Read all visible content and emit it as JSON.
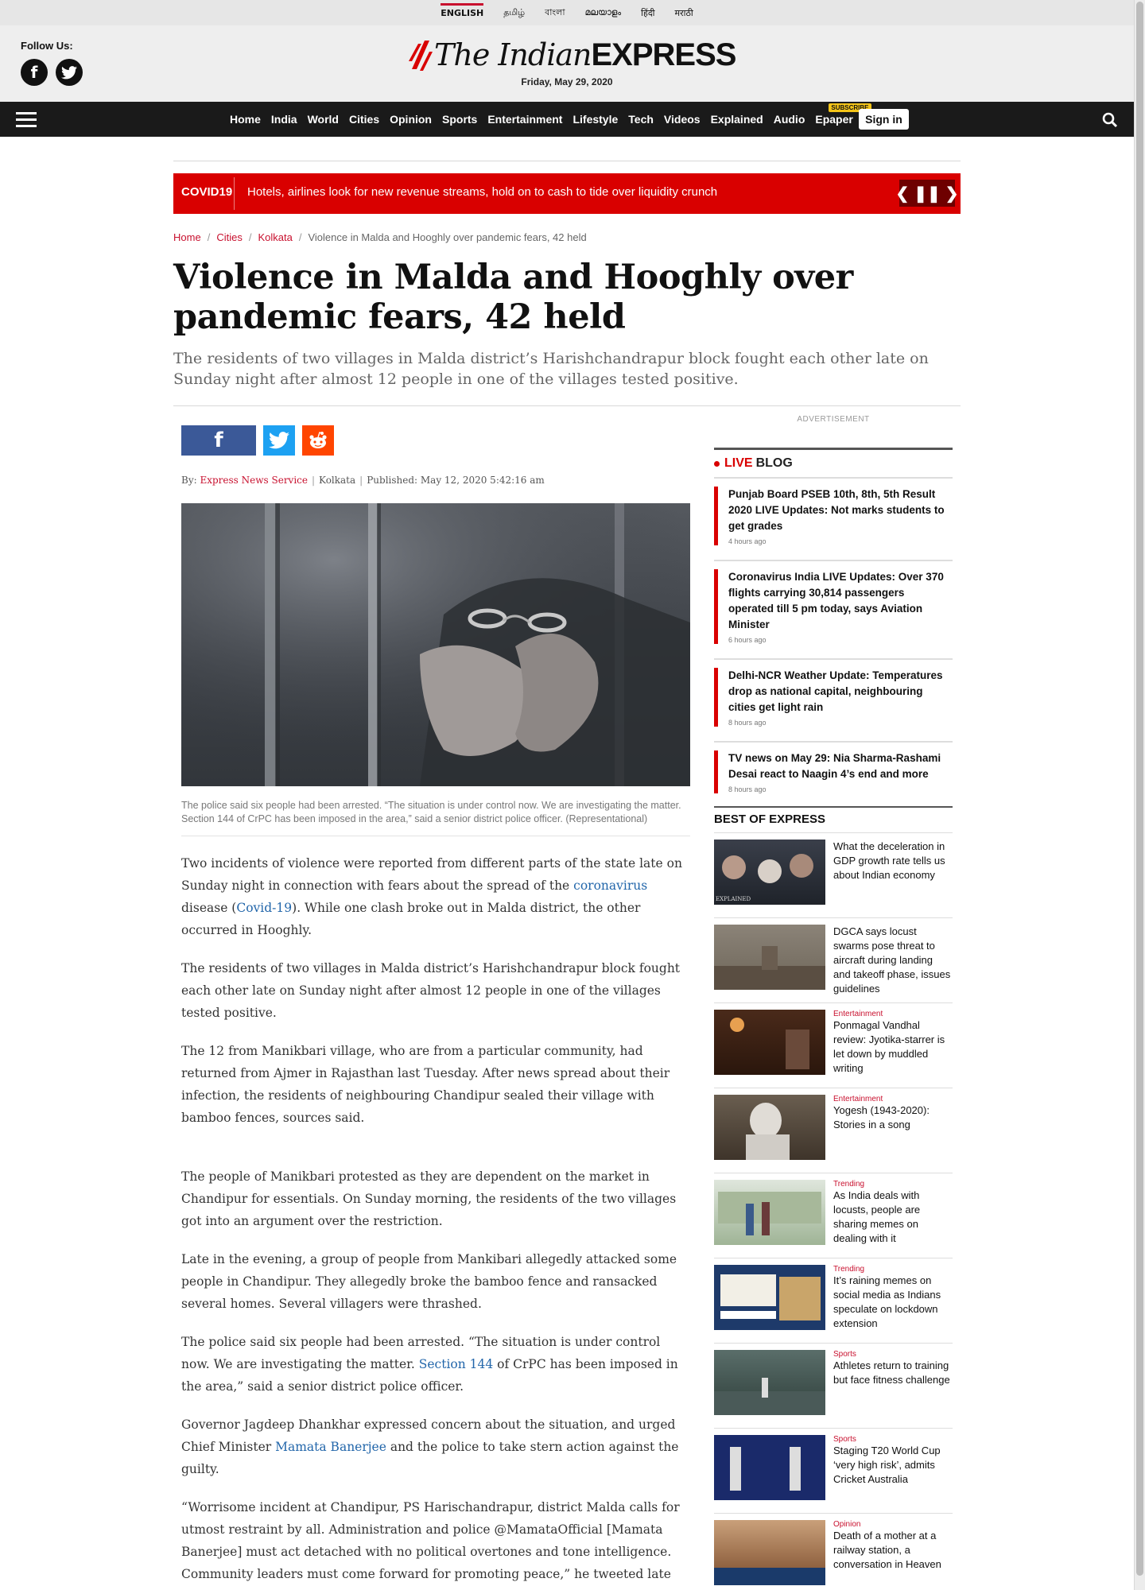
{
  "languages": [
    {
      "label": "ENGLISH",
      "active": true
    },
    {
      "label": "தமிழ்"
    },
    {
      "label": "বাংলা"
    },
    {
      "label": "മലയാളം"
    },
    {
      "label": "हिंदी"
    },
    {
      "label": "मराठी"
    }
  ],
  "masthead": {
    "follow_label": "Follow Us:",
    "social": [
      {
        "icon": "facebook-icon",
        "glyph": "f"
      },
      {
        "icon": "twitter-icon"
      }
    ],
    "logo_italic": "The Indian",
    "logo_bold": "EXPRESS",
    "date": "Friday, May 29, 2020"
  },
  "nav": {
    "links": [
      "Home",
      "India",
      "World",
      "Cities",
      "Opinion",
      "Sports",
      "Entertainment",
      "Lifestyle",
      "Tech",
      "Videos",
      "Explained",
      "Audio",
      "Epaper"
    ],
    "epaper_badge": "SUBSCRIBE",
    "signin": "Sign in"
  },
  "ticker": {
    "tag": "COVID19",
    "text": "Hotels, airlines look for new revenue streams, hold on to cash to tide over liquidity crunch",
    "controls": [
      "❮",
      "❚❚",
      "❯"
    ]
  },
  "breadcrumb": [
    "Home",
    "Cities",
    "Kolkata",
    "Violence in Malda and Hooghly over pandemic fears, 42 held"
  ],
  "article": {
    "headline": "Violence in Malda and Hooghly over pandemic fears, 42 held",
    "standfirst": "The residents of two villages in Malda district’s Harishchandrapur block fought each other late on Sunday night after almost 12 people in one of the villages tested positive.",
    "byline_prefix": "By:",
    "author": "Express News Service",
    "location": "Kolkata",
    "published": "Published: May 12, 2020 5:42:16 am",
    "caption": "The police said six people had been arrested. “The situation is under control now. We are investigating the matter. Section 144 of CrPC has been imposed in the area,” said a senior district police officer. (Representational)",
    "p1": {
      "a": "Two incidents of violence were reported from different parts of the state late on Sunday night in connection with fears about the spread of the ",
      "link1": "coronavirus",
      "b": " disease (",
      "link2": "Covid-19",
      "c": "). While one clash broke out in Malda district, the other occurred in Hooghly."
    },
    "p2": "The residents of two villages in Malda district’s Harishchandrapur block fought each other late on Sunday night after almost 12 people in one of the villages tested positive.",
    "p3": "The 12 from Manikbari village, who are from a particular community, had returned from Ajmer in Rajasthan last Tuesday. After news spread about their infection, the residents of neighbouring Chandipur sealed their village with bamboo fences, sources said.",
    "p4": "The people of Manikbari protested as they are dependent on the market in Chandipur for essentials. On Sunday morning, the residents of the two villages got into an argument over the restriction.",
    "p5": "Late in the evening, a group of people from Mankibari allegedly attacked some people in Chandipur. They allegedly broke the bamboo fence and ransacked several homes. Several villagers were thrashed.",
    "p6": {
      "a": "The police said six people had been arrested. “The situation is under control now. We are investigating the matter. ",
      "link": "Section 144",
      "b": " of CrPC has been imposed in the area,” said a senior district police officer."
    },
    "p7": {
      "a": "Governor Jagdeep Dhankhar expressed concern about the situation, and urged Chief Minister ",
      "link": "Mamata Banerjee",
      "b": " and the police to take stern action against the guilty."
    },
    "p8": "“Worrisome incident at Chandipur, PS Harischandrapur, district Malda calls for utmost restraint by all. Administration and police @MamataOfficial [Mamata Banerjee] must act detached with no political overtones and tone intelligence. Community leaders must come forward for promoting peace,” he tweeted late on"
  },
  "sidebar": {
    "ad_label": "ADVERTISEMENT",
    "liveblog": {
      "live": "LIVE",
      "blog": "BLOG",
      "items": [
        {
          "title": "Punjab Board PSEB 10th, 8th, 5th Result 2020 LIVE Updates: Not marks students to get grades",
          "time": "4 hours ago"
        },
        {
          "title": "Coronavirus India LIVE Updates: Over 370 flights carrying 30,814 passengers operated till 5 pm today, says Aviation Minister",
          "time": "6 hours ago"
        },
        {
          "title": "Delhi-NCR Weather Update: Temperatures drop as national capital, neighbouring cities get light rain",
          "time": "8 hours ago"
        },
        {
          "title": "TV news on May 29: Nia Sharma-Rashami Desai react to Naagin 4’s end and more",
          "time": "8 hours ago"
        }
      ]
    },
    "best": {
      "heading": "BEST OF EXPRESS",
      "items": [
        {
          "category": "",
          "title": "What the deceleration in GDP growth rate tells us about Indian economy",
          "thumb_label": "EXPLAINED"
        },
        {
          "category": "",
          "title": "DGCA says locust swarms pose threat to aircraft during landing and takeoff phase, issues guidelines"
        },
        {
          "category": "Entertainment",
          "title": "Ponmagal Vandhal review: Jyotika-starrer is let down by muddled writing"
        },
        {
          "category": "Entertainment",
          "title": "Yogesh (1943-2020): Stories in a song"
        },
        {
          "category": "Trending",
          "title": "As India deals with locusts, people are sharing memes on dealing with it"
        },
        {
          "category": "Trending",
          "title": "It’s raining memes on social media as Indians speculate on lockdown extension"
        },
        {
          "category": "Sports",
          "title": "Athletes return to training but face fitness challenge"
        },
        {
          "category": "Sports",
          "title": "Staging T20 World Cup ‘very high risk’, admits Cricket Australia"
        },
        {
          "category": "Opinion",
          "title": "Death of a mother at a railway station, a conversation in Heaven"
        }
      ]
    }
  },
  "colors": {
    "brand_red": "#c8102e",
    "ticker_red": "#d90000",
    "nav_bg": "#1a1a1a",
    "link_blue": "#2266aa"
  }
}
